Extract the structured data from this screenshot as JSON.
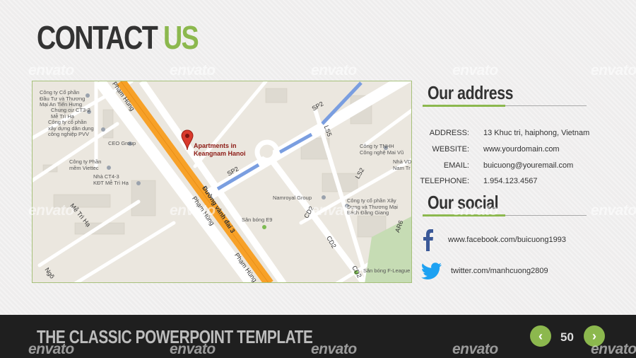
{
  "header": {
    "title_part1": "CONTACT",
    "title_part2": "US"
  },
  "map": {
    "pin_label_line1": "Apartments in",
    "pin_label_line2": "Keangnam Hanoi",
    "places": [
      "Công ty Cổ phần\nĐầu Tư và Thương\nMại An Tiến Hưng",
      "Chung cư CT3-2\nMễ Trì Hạ",
      "Công ty cổ phần\nxây dựng dân dụng\ncông nghiệp PVV",
      "CEO Group",
      "Công ty Phần\nmềm Viettec",
      "Nhà CT4-3\nKĐT Mễ Trì Hạ",
      "Công ty TNHH\nCông nghệ Mai Vũ",
      "Nhà VD Bé\nNam Tr",
      "Namroyal Group",
      "Công ty cổ phần Xây\nDựng và Thương Mại\nBách Đằng Giang",
      "Sân bóng E9",
      "Sân bóng F-League"
    ],
    "roads": {
      "pham_hung": "Phạm Hùng",
      "vanh_dai": "Đường vành đai 3",
      "sp2": "SP2",
      "ls5": "LS5",
      "ls2": "LS2",
      "cd2": "CD2",
      "ar6": "AR6",
      "me_tri_ha": "Mễ Trì Hạ",
      "ngo": "Ngõ"
    }
  },
  "address": {
    "heading": "Our address",
    "rows": [
      {
        "label": "ADDRESS:",
        "value": "13 Khuc tri, haiphong, Vietnam"
      },
      {
        "label": "WEBSITE:",
        "value": "www.yourdomain.com"
      },
      {
        "label": "EMAIL:",
        "value": "buicuong@youremail.com"
      },
      {
        "label": "TELEPHONE:",
        "value": "1.954.123.4567"
      }
    ]
  },
  "social": {
    "heading": "Our social",
    "facebook": "www.facebook.com/buicuong1993",
    "twitter": "twitter.com/manhcuong2809"
  },
  "footer": {
    "title": "THE CLASSIC POWERPOINT TEMPLATE",
    "page_number": "50",
    "prev_icon": "chevron-left-icon",
    "next_icon": "chevron-right-icon"
  },
  "watermark": "envato",
  "colors": {
    "accent": "#8cb84e",
    "dark": "#333333",
    "footer_bg": "#1f1f1f",
    "facebook": "#3b5998",
    "twitter": "#1da1f2",
    "highway": "#f7a128"
  }
}
